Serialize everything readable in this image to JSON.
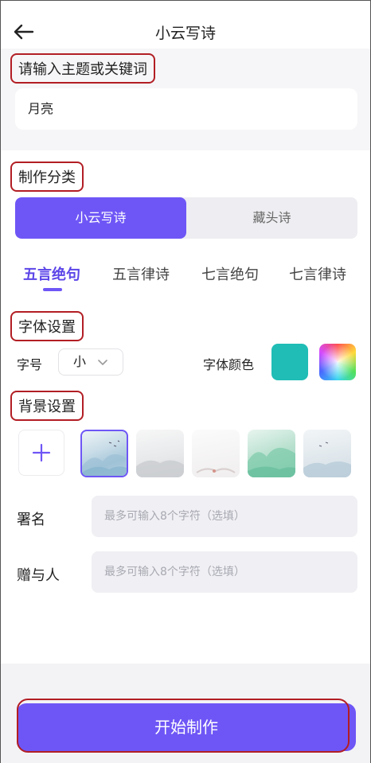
{
  "header": {
    "title": "小云写诗"
  },
  "theme_section": {
    "label": "请输入主题或关键词",
    "input_value": "月亮"
  },
  "category_section": {
    "label": "制作分类",
    "segments": [
      "小云写诗",
      "藏头诗"
    ],
    "active_segment": 0,
    "tabs": [
      "五言绝句",
      "五言律诗",
      "七言绝句",
      "七言律诗"
    ],
    "active_tab": 0
  },
  "font_section": {
    "label": "字体设置",
    "size_label": "字号",
    "size_value": "小",
    "color_label": "字体颜色",
    "selected_color": "#1fbdb6"
  },
  "background_section": {
    "label": "背景设置",
    "thumbnails": [
      "landscape-1",
      "landscape-2",
      "landscape-3",
      "landscape-4",
      "landscape-5"
    ],
    "selected_thumbnail": 0
  },
  "signature": {
    "label": "署名",
    "placeholder": "最多可输入8个字符（选填）"
  },
  "recipient": {
    "label": "赠与人",
    "placeholder": "最多可输入8个字符（选填）"
  },
  "start_button": {
    "label": "开始制作"
  },
  "colors": {
    "accent": "#6e56f6",
    "annotation": "#b21e24"
  }
}
